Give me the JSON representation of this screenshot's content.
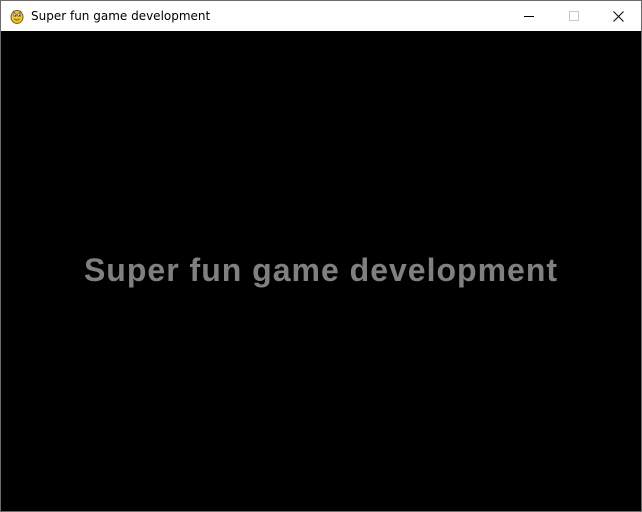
{
  "window": {
    "title": "Super fun game development",
    "app_icon": "pygame-snake-icon"
  },
  "controls": {
    "minimize_icon": "minimize-icon",
    "maximize_icon": "maximize-icon",
    "close_icon": "close-icon"
  },
  "game": {
    "text": "Super fun game development",
    "text_color": "#808080",
    "background_color": "#000000"
  }
}
